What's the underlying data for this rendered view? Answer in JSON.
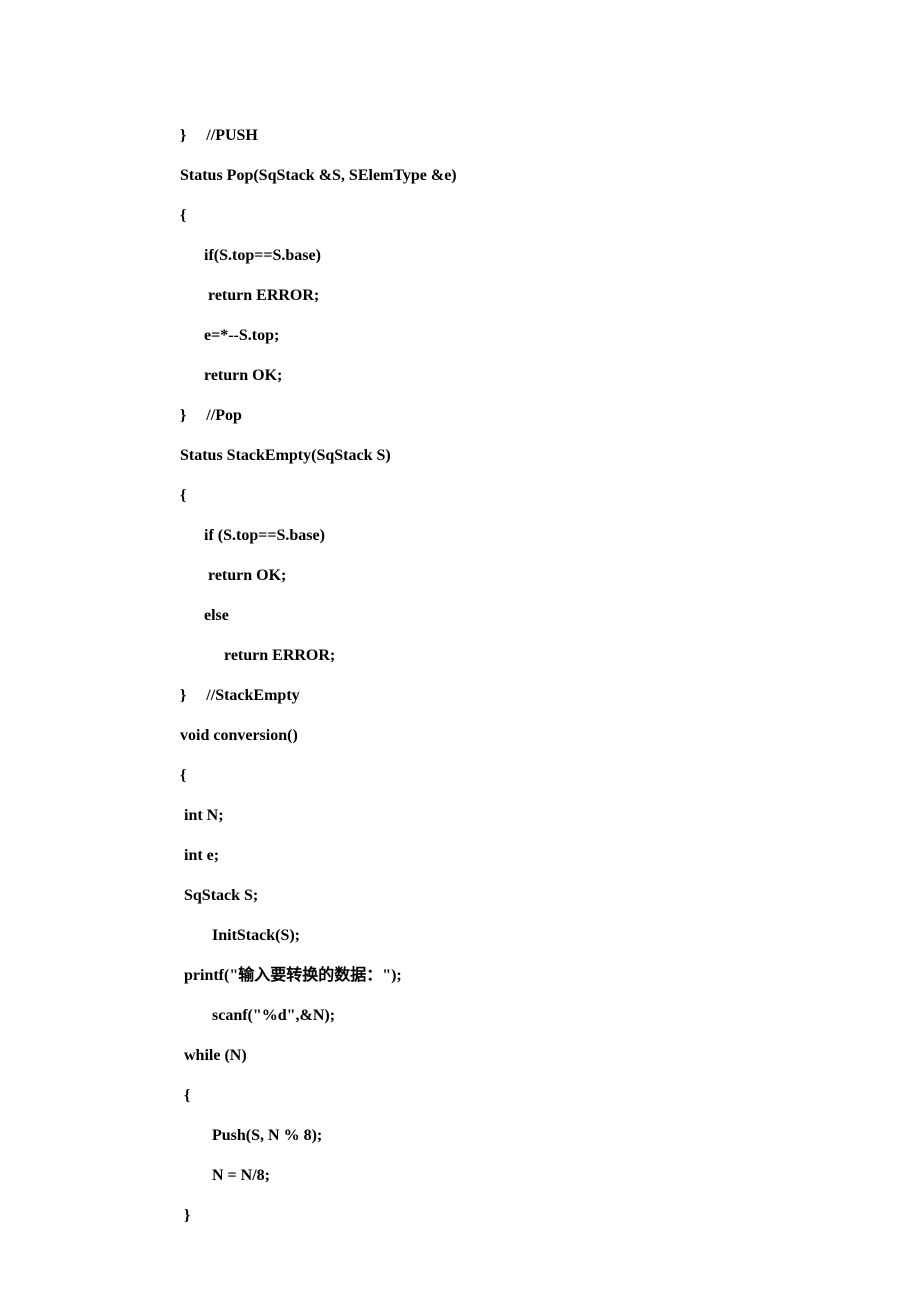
{
  "code": {
    "lines": [
      "}     //PUSH",
      "Status Pop(SqStack &S, SElemType &e)",
      "{",
      "      if(S.top==S.base)",
      "       return ERROR;",
      "      e=*--S.top;",
      "      return OK;",
      "}     //Pop",
      "",
      "Status StackEmpty(SqStack S)",
      "{",
      "      if (S.top==S.base)",
      "       return OK;",
      "      else",
      "           return ERROR;",
      "}     //StackEmpty",
      "void conversion()",
      "{",
      " int N;",
      " int e;",
      " SqStack S;",
      "        InitStack(S);",
      " printf(\"输入要转换的数据：\");",
      "        scanf(\"%d\",&N);",
      " while (N)",
      " {",
      "        Push(S, N % 8);",
      "        N = N/8;",
      " }"
    ]
  }
}
